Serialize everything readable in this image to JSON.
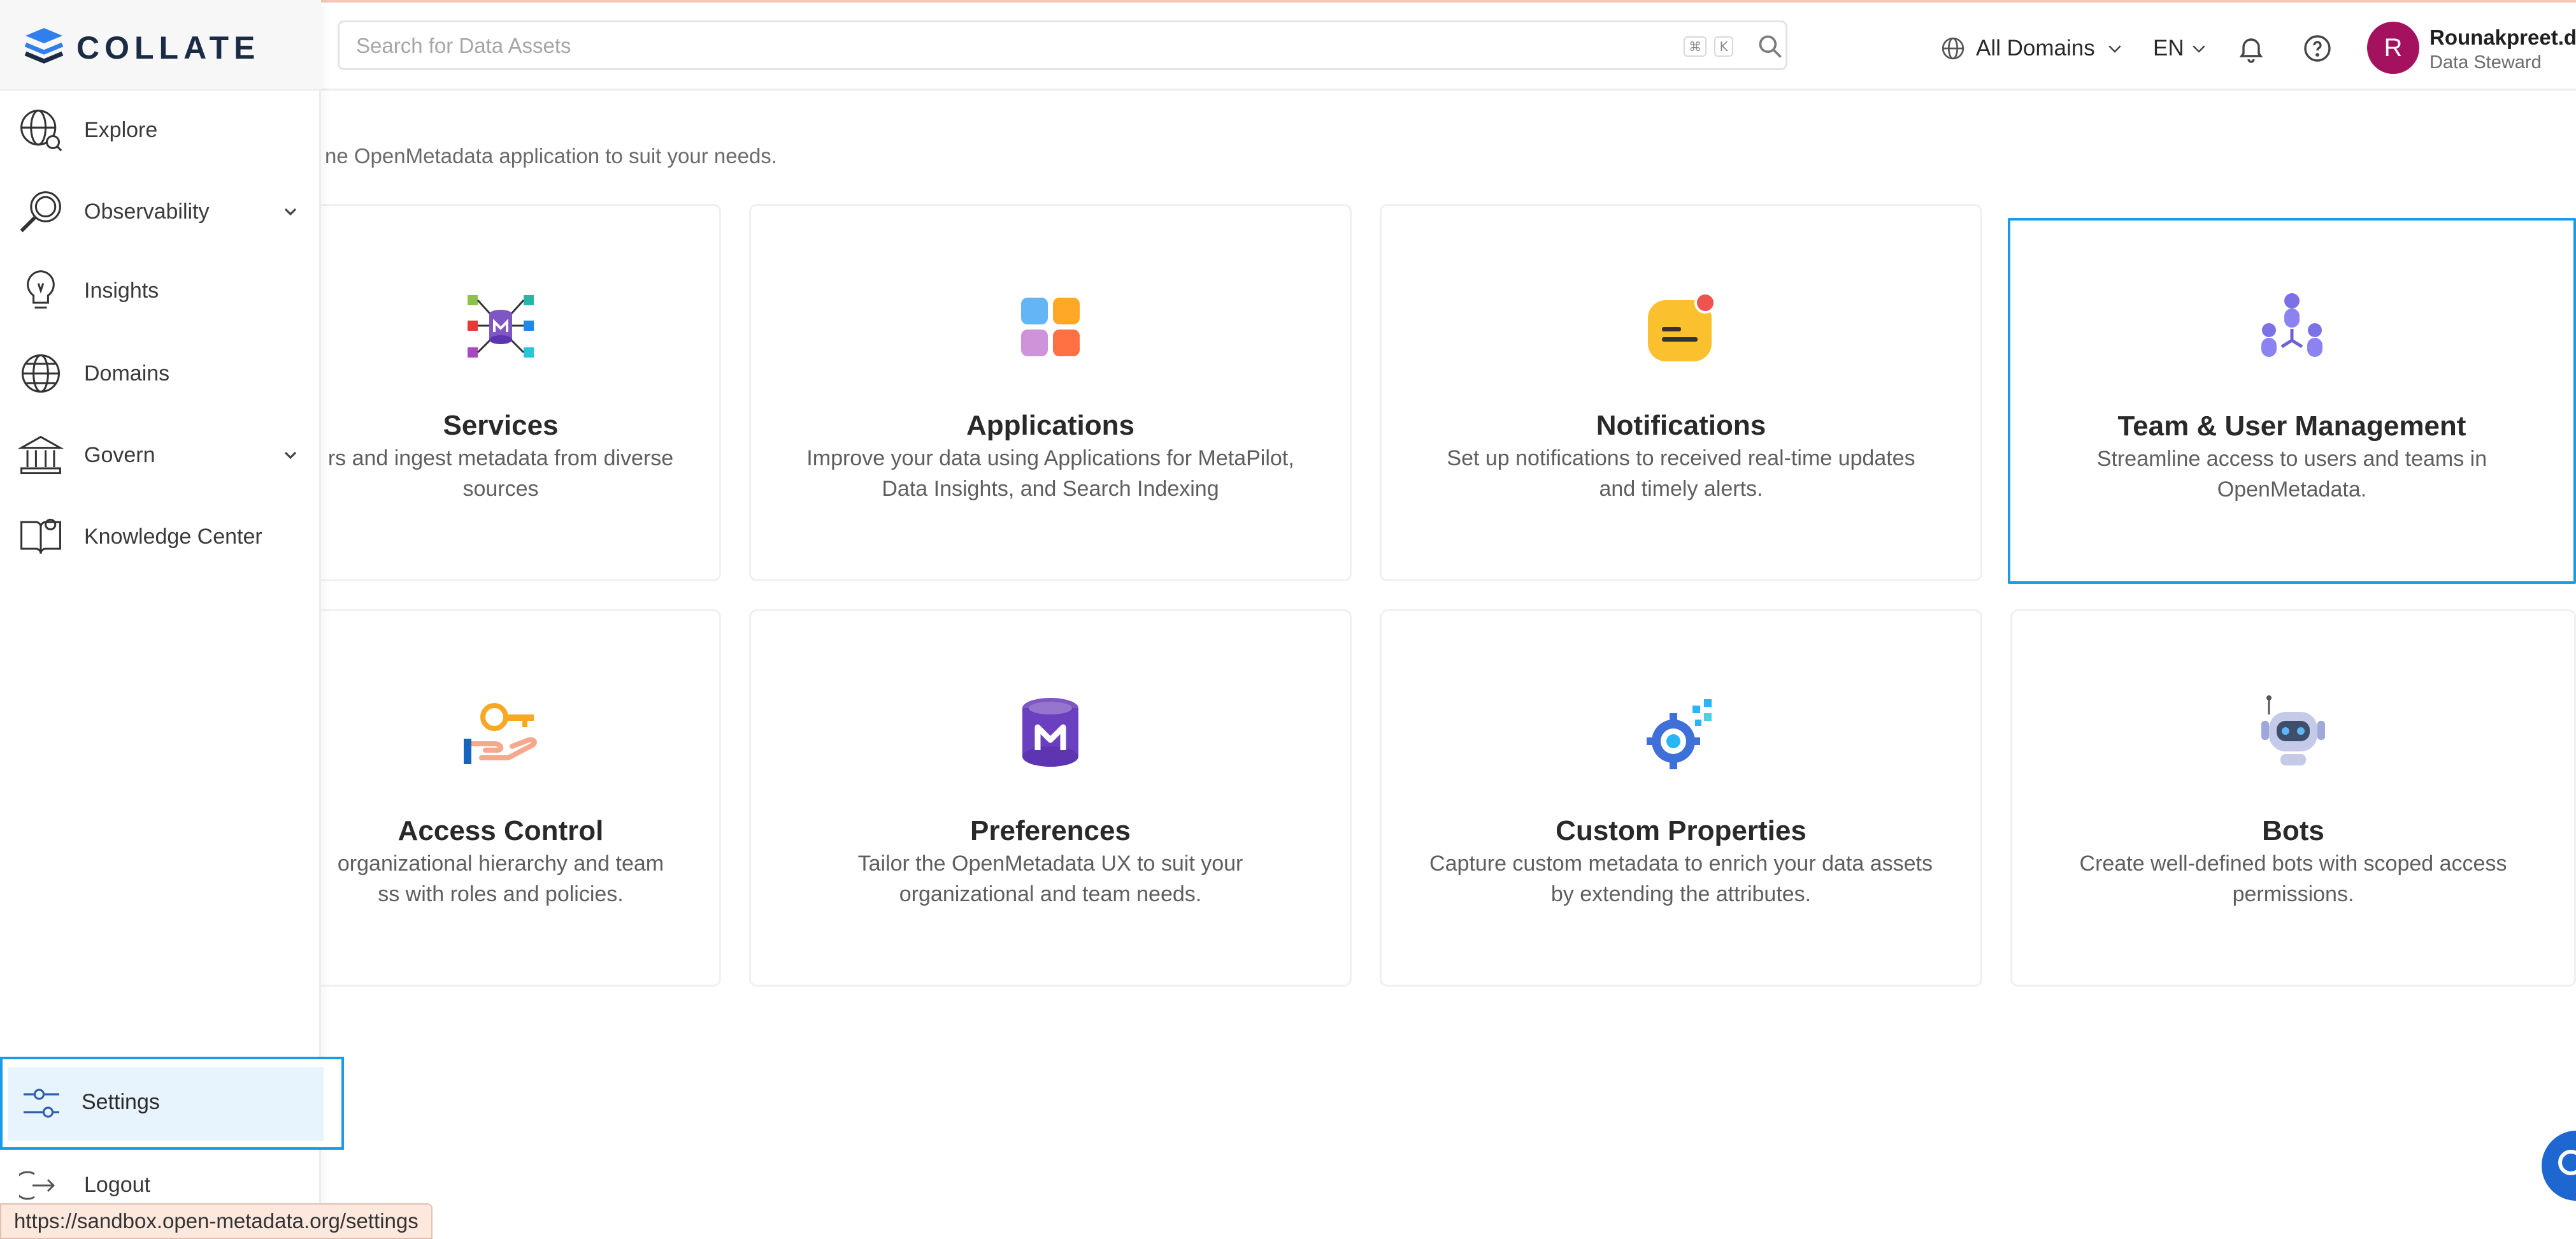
{
  "brand": {
    "name": "COLLATE"
  },
  "search": {
    "placeholder": "Search for Data Assets",
    "shortcut_cmd": "⌘",
    "shortcut_key": "K"
  },
  "header": {
    "domains_label": "All Domains",
    "language": "EN",
    "user": {
      "initial": "R",
      "name": "Rounakpreet.d",
      "role": "Data Steward"
    }
  },
  "sidebar": {
    "items": [
      {
        "label": "Explore"
      },
      {
        "label": "Observability"
      },
      {
        "label": "Insights"
      },
      {
        "label": "Domains"
      },
      {
        "label": "Govern"
      },
      {
        "label": "Knowledge Center"
      }
    ],
    "settings_label": "Settings",
    "logout_label": "Logout"
  },
  "main": {
    "subtitle": "ne OpenMetadata application to suit your needs.",
    "cards": [
      {
        "title": "Services",
        "desc": "rs and ingest metadata from diverse sources"
      },
      {
        "title": "Applications",
        "desc": "Improve your data using Applications for MetaPilot, Data Insights, and Search Indexing"
      },
      {
        "title": "Notifications",
        "desc": "Set up notifications to received real-time updates and timely alerts."
      },
      {
        "title": "Team & User Management",
        "desc": "Streamline access to users and teams in OpenMetadata."
      },
      {
        "title": "Access Control",
        "desc": "organizational hierarchy and team ss with roles and policies."
      },
      {
        "title": "Preferences",
        "desc": "Tailor the OpenMetadata UX to suit your organizational and team needs."
      },
      {
        "title": "Custom Properties",
        "desc": "Capture custom metadata to enrich your data assets by extending the attributes."
      },
      {
        "title": "Bots",
        "desc": "Create well-defined bots with scoped access permissions."
      }
    ]
  },
  "status_url": "https://sandbox.open-metadata.org/settings",
  "colors": {
    "accent": "#1a9be8",
    "avatar": "#a4125f",
    "brand_dark": "#1b2b45"
  }
}
